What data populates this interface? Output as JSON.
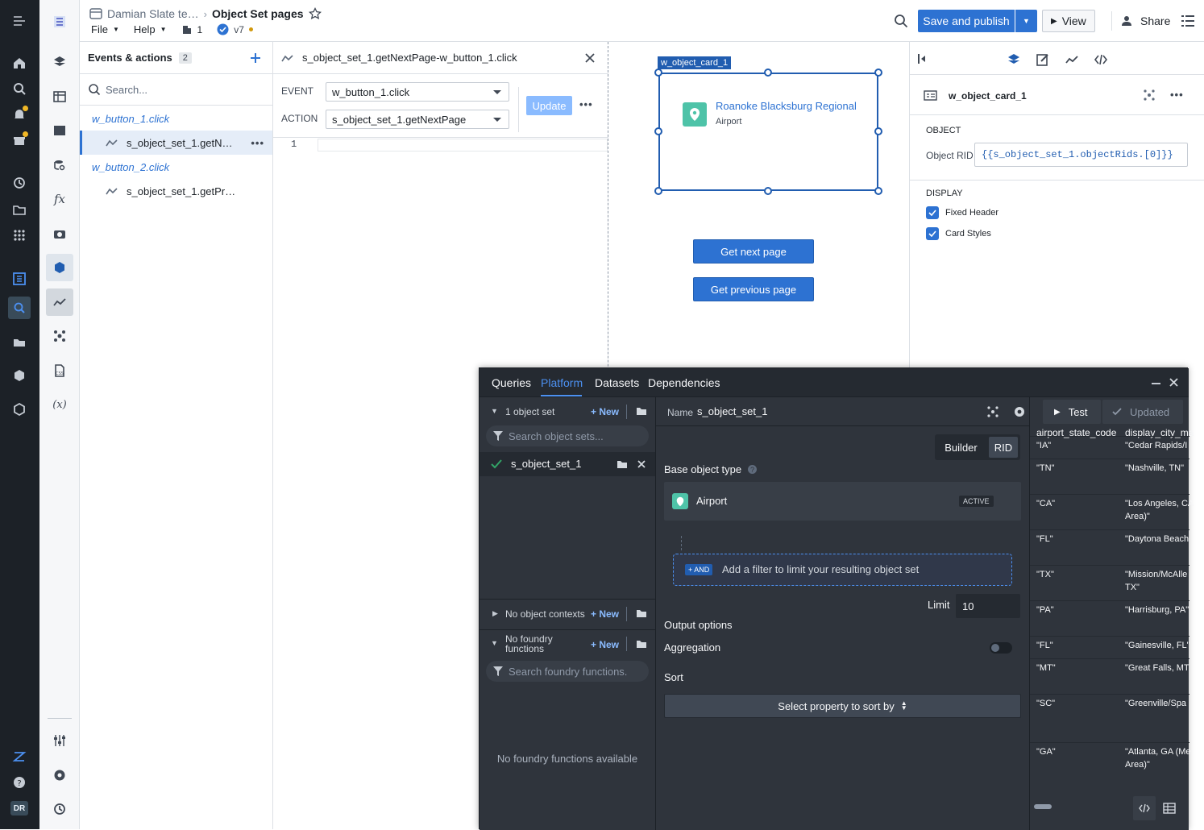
{
  "header": {
    "breadcrumb_parent": "Damian Slate te…",
    "page_title": "Object Set pages",
    "menu_file": "File",
    "menu_help": "Help",
    "pages_count": "1",
    "version": "v7",
    "save_publish": "Save and publish",
    "view": "View",
    "share": "Share"
  },
  "events": {
    "title": "Events & actions",
    "count": "2",
    "search_placeholder": "Search...",
    "group1": "w_button_1.click",
    "item1": "s_object_set_1.getN…",
    "group2": "w_button_2.click",
    "item2": "s_object_set_1.getPr…"
  },
  "editor": {
    "title": "s_object_set_1.getNextPage-w_button_1.click",
    "event_label": "EVENT",
    "event_value": "w_button_1.click",
    "action_label": "ACTION",
    "action_value": "s_object_set_1.getNextPage",
    "update": "Update",
    "line_number": "1"
  },
  "canvas": {
    "card_tag": "w_object_card_1",
    "card_title": "Roanoke Blacksburg Regional",
    "card_subtitle": "Airport",
    "btn_next": "Get next page",
    "btn_prev": "Get previous page"
  },
  "props": {
    "widget_name": "w_object_card_1",
    "section_object": "OBJECT",
    "object_rid_label": "Object RID",
    "object_rid_value": "{{s_object_set_1.objectRids.[0]}}",
    "section_display": "DISPLAY",
    "fixed_header": "Fixed Header",
    "card_styles": "Card Styles"
  },
  "dock": {
    "tabs": [
      "Queries",
      "Platform",
      "Datasets",
      "Dependencies"
    ],
    "object_set_count": "1 object set",
    "new": "New",
    "search_sets": "Search object sets...",
    "set_name": "s_object_set_1",
    "no_contexts": "No object contexts",
    "no_functions": "No foundry functions",
    "search_functions": "Search foundry functions.",
    "no_functions_available": "No foundry functions available",
    "name_label": "Name",
    "name_value": "s_object_set_1",
    "test": "Test",
    "updated": "Updated",
    "builder": "Builder",
    "rid": "RID",
    "base_type_label": "Base object type",
    "base_type_value": "Airport",
    "active": "ACTIVE",
    "and_tag": "+ AND",
    "filter_hint": "Add a filter to limit your resulting object set",
    "limit_label": "Limit",
    "limit_value": "10",
    "output_options": "Output options",
    "aggregation": "Aggregation",
    "sort": "Sort",
    "sort_select": "Select property to sort by"
  },
  "table": {
    "headers": [
      "airport_state_code",
      "display_city_ma"
    ],
    "rows": [
      {
        "a": "\"IA\"",
        "b": "\"Cedar Rapids/I"
      },
      {
        "a": "\"TN\"",
        "b": "\"Nashville, TN\""
      },
      {
        "a": "\"CA\"",
        "b": "\"Los Angeles, CA",
        "b2": "Area)\""
      },
      {
        "a": "\"FL\"",
        "b": "\"Daytona Beach"
      },
      {
        "a": "\"TX\"",
        "b": "\"Mission/McAlle",
        "b2": "TX\""
      },
      {
        "a": "\"PA\"",
        "b": "\"Harrisburg, PA\""
      },
      {
        "a": "\"FL\"",
        "b": "\"Gainesville, FL\""
      },
      {
        "a": "\"MT\"",
        "b": "\"Great Falls, MT"
      },
      {
        "a": "\"SC\"",
        "b": "\"Greenville/Spa"
      },
      {
        "a": "\"GA\"",
        "b": "\"Atlanta, GA (Me",
        "b2": "Area)\""
      }
    ]
  },
  "colors": {
    "accent": "#2d72d2",
    "dark_panel": "#2f343c",
    "rail": "#1c2127"
  }
}
